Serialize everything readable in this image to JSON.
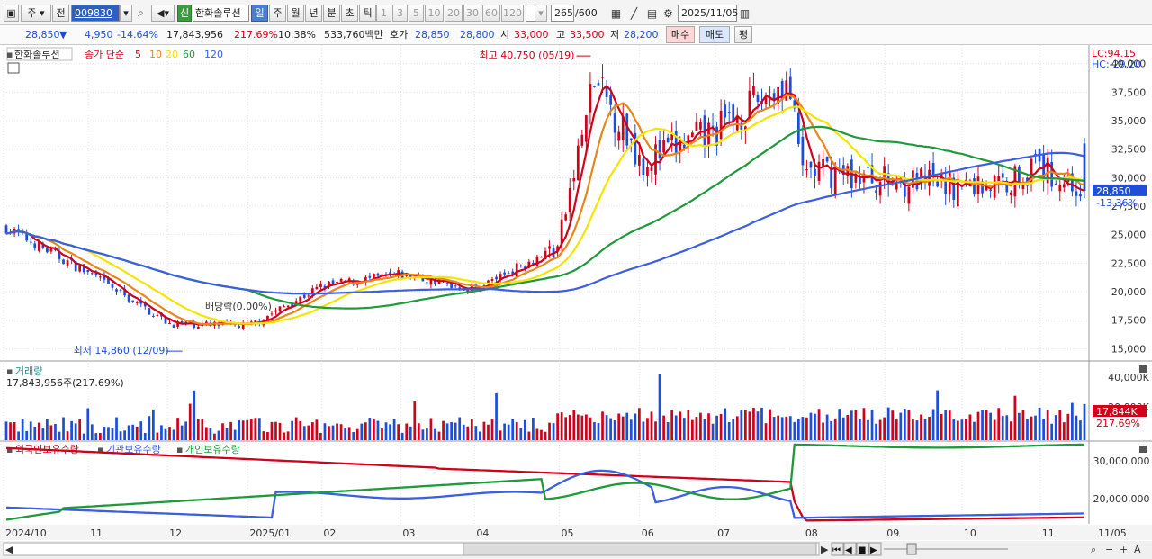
{
  "toolbar": {
    "code": "009830",
    "stock_name": "한화솔루션",
    "badge": "신",
    "period_tabs": [
      "일",
      "주",
      "월",
      "년",
      "분",
      "초",
      "틱"
    ],
    "active_tab": "일",
    "minute_buttons": [
      "1",
      "3",
      "5",
      "10",
      "20",
      "30",
      "60",
      "120"
    ],
    "count": "265",
    "total": "/600",
    "date": "2025/11/05",
    "menu_ju": "주",
    "menu_jeon": "전"
  },
  "quote": {
    "price": "28,850",
    "change": "4,950",
    "change_pct": "-14.64%",
    "volume": "17,843,956",
    "vol_ratio": "217.69%",
    "turnover": "10.38%",
    "amount": "533,760백만",
    "hoga_label": "호가",
    "hoga_ask": "28,850",
    "hoga_bid": "28,800",
    "open_label": "시",
    "open": "33,000",
    "high_label": "고",
    "high": "33,500",
    "low_label": "저",
    "low": "28,200",
    "buy_label": "매수",
    "sell_label": "매도",
    "eval_label": "평"
  },
  "price_panel": {
    "title": "한화솔루션",
    "ma_label": "종가 단순",
    "ma_periods": [
      "5",
      "10",
      "20",
      "60",
      "120"
    ],
    "ma_colors": [
      "#d0021b",
      "#e8861a",
      "#f5e400",
      "#1f9a3a",
      "#3b5fe0"
    ],
    "lc": "LC:94.15",
    "hc": "HC:-29.20",
    "y_ticks": [
      "40,000",
      "37,500",
      "35,000",
      "32,500",
      "30,000",
      "27,500",
      "25,000",
      "22,500",
      "20,000",
      "17,500",
      "15,000"
    ],
    "current_price": "28,850",
    "current_pct": "-13.36%",
    "high_annotation": "최고 40,750 (05/19)",
    "low_annotation": "최저 14,860 (12/09)",
    "dividend_annotation": "배당락(0.00%)"
  },
  "volume_panel": {
    "title": "거래량",
    "value": "17,843,956주(217.69%)",
    "y_ticks": [
      "40,000K",
      "20,000K"
    ],
    "current": "17,844K",
    "current_pct": "217.69%"
  },
  "holdings_panel": {
    "legend": [
      "외국인보유수량",
      "기관보유수량",
      "개인보유수량"
    ],
    "legend_colors": [
      "#d0021b",
      "#3b5fe0",
      "#1f9a3a"
    ],
    "y_ticks": [
      "30,000,000",
      "20,000,000"
    ]
  },
  "x_axis": [
    "2024/10",
    "11",
    "12",
    "2025/01",
    "02",
    "03",
    "04",
    "05",
    "06",
    "07",
    "08",
    "09",
    "10",
    "11",
    "11/05"
  ],
  "chart_data": {
    "type": "candlestick",
    "title": "한화솔루션",
    "ylim": [
      14000,
      41000
    ],
    "months": [
      "2024/10",
      "11",
      "12",
      "2025/01",
      "02",
      "03",
      "04",
      "05",
      "06",
      "07",
      "08",
      "09",
      "10",
      "11"
    ],
    "close_trend": [
      25600,
      21500,
      17200,
      17000,
      20500,
      21500,
      20200,
      24000,
      38500,
      31500,
      34000,
      38500,
      30800,
      29800,
      29300,
      29500,
      31000,
      28850
    ],
    "trend_dates": [
      "2024/10",
      "2024/11",
      "2024/12",
      "2025/01",
      "2025/02",
      "2025/03",
      "2025/04",
      "2025/05",
      "2025/05",
      "2025/06",
      "2025/07",
      "2025/07",
      "2025/08",
      "2025/09",
      "2025/10",
      "2025/10",
      "2025/11",
      "2025/11/05"
    ],
    "high": {
      "value": 40750,
      "date": "05/19"
    },
    "low": {
      "value": 14860,
      "date": "12/09"
    }
  }
}
